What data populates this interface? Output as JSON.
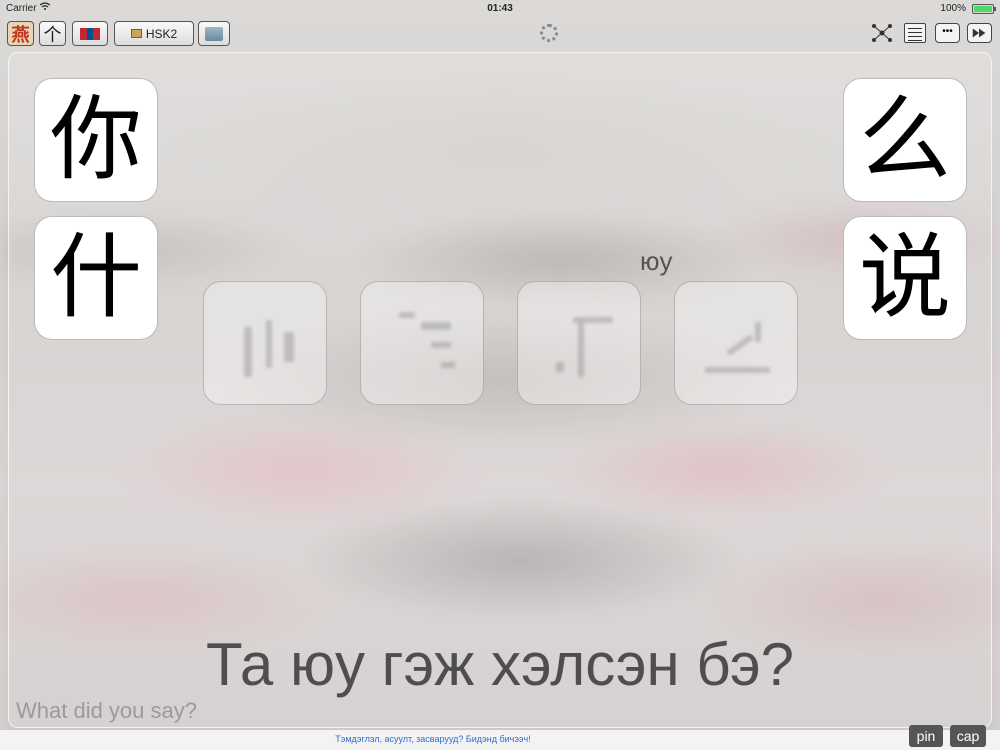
{
  "status_bar": {
    "carrier": "Carrier",
    "time": "01:43",
    "battery_percent": "100%"
  },
  "toolbar": {
    "app_icon_glyph": "燕",
    "up_glyph": "个",
    "deck_label": "HSK2",
    "flag_colors": [
      "#c4272f",
      "#015197",
      "#c4272f"
    ]
  },
  "characters": {
    "top_left": "你",
    "bottom_left": "什",
    "top_right": "么",
    "bottom_right": "说"
  },
  "pinyin_hint": "юу",
  "translation": "Та юу гэж хэлсэн бэ?",
  "english": "What did you say?",
  "footer": {
    "feedback_text": "Тэмдэглэл, асуулт, засварууд? Бидэнд бичээч!",
    "pin_label": "pin",
    "cap_label": "cap"
  },
  "icons": {
    "wifi": "wifi-icon",
    "battery": "battery-icon",
    "spinner": "activity-spinner-icon",
    "network": "network-graph-icon",
    "text": "text-lines-icon",
    "speech": "speech-bubble-icon",
    "fast_forward": "fast-forward-icon",
    "folder": "folder-icon",
    "book": "book-icon"
  }
}
